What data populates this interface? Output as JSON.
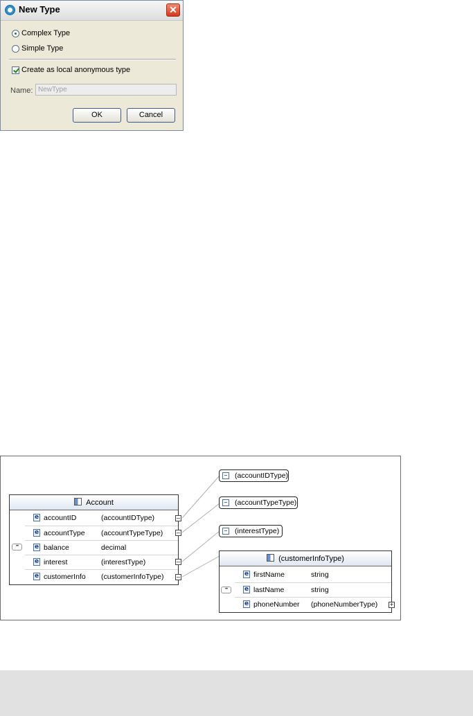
{
  "dialog": {
    "title": "New Type",
    "options": {
      "complex_type": "Complex Type",
      "simple_type": "Simple Type",
      "selected": "Complex Type"
    },
    "local_anonymous": {
      "label": "Create as local anonymous type",
      "checked": true
    },
    "name": {
      "label": "Name:",
      "value": "NewType",
      "enabled": false
    },
    "ok_label": "OK",
    "cancel_label": "Cancel"
  },
  "diagram": {
    "account": {
      "title": "Account",
      "rows": [
        {
          "name": "accountID",
          "type": "(accountIDType)"
        },
        {
          "name": "accountType",
          "type": "(accountTypeType)"
        },
        {
          "name": "balance",
          "type": "decimal"
        },
        {
          "name": "interest",
          "type": "(interestType)"
        },
        {
          "name": "customerInfo",
          "type": "(customerInfoType)"
        }
      ]
    },
    "simple_types": [
      "(accountIDType)",
      "(accountTypeType)",
      "(interestType)"
    ],
    "customer_info": {
      "title": "(customerInfoType)",
      "rows": [
        {
          "name": "firstName",
          "type": "string"
        },
        {
          "name": "lastName",
          "type": "string"
        },
        {
          "name": "phoneNumber",
          "type": "(phoneNumberType)"
        }
      ]
    },
    "element_icon": "e",
    "colors": {
      "element_icon": "#4a6fae",
      "header_gradient": "#dfe7f2",
      "close_button": "#d23a1c"
    }
  }
}
